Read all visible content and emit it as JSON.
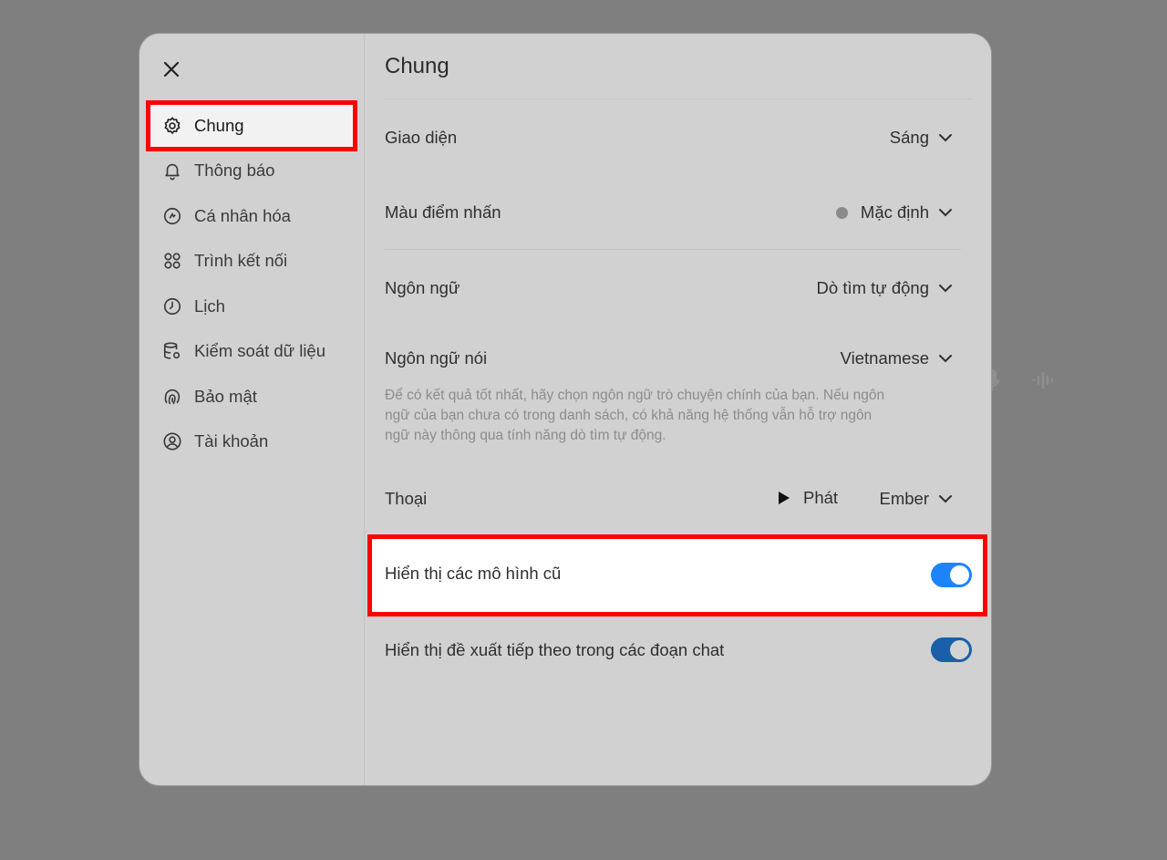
{
  "background": {
    "icons": [
      "microphone-icon",
      "waveform-icon"
    ]
  },
  "sidebar": {
    "close_icon": "close-icon",
    "items": [
      {
        "label": "Chung",
        "icon": "gear-icon",
        "active": true
      },
      {
        "label": "Thông báo",
        "icon": "bell-icon"
      },
      {
        "label": "Cá nhân hóa",
        "icon": "personalize-icon"
      },
      {
        "label": "Trình kết nối",
        "icon": "connectors-icon"
      },
      {
        "label": "Lịch",
        "icon": "clock-icon"
      },
      {
        "label": "Kiểm soát dữ liệu",
        "icon": "database-icon"
      },
      {
        "label": "Bảo mật",
        "icon": "fingerprint-icon"
      },
      {
        "label": "Tài khoản",
        "icon": "user-circle-icon"
      }
    ]
  },
  "main": {
    "title": "Chung",
    "settings": {
      "theme": {
        "label": "Giao diện",
        "value": "Sáng"
      },
      "accent": {
        "label": "Màu điểm nhấn",
        "value": "Mặc định"
      },
      "language": {
        "label": "Ngôn ngữ",
        "value": "Dò tìm tự động"
      },
      "spoken_language": {
        "label": "Ngôn ngữ nói",
        "value": "Vietnamese",
        "helper": "Để có kết quả tốt nhất, hãy chọn ngôn ngữ trò chuyện chính của bạn. Nếu ngôn ngữ của bạn chưa có trong danh sách, có khả năng hệ thống vẫn hỗ trợ ngôn ngữ này thông qua tính năng dò tìm tự động."
      },
      "voice": {
        "label": "Thoại",
        "play_label": "Phát",
        "value": "Ember"
      },
      "legacy_models": {
        "label": "Hiển thị các mô hình cũ",
        "enabled": true
      },
      "follow_up": {
        "label": "Hiển thị đề xuất tiếp theo trong các đoạn chat",
        "enabled": true
      }
    }
  },
  "colors": {
    "highlight": "#ff0000",
    "toggle_on": "#1d84ff",
    "overlay": "#7f7f7f"
  }
}
